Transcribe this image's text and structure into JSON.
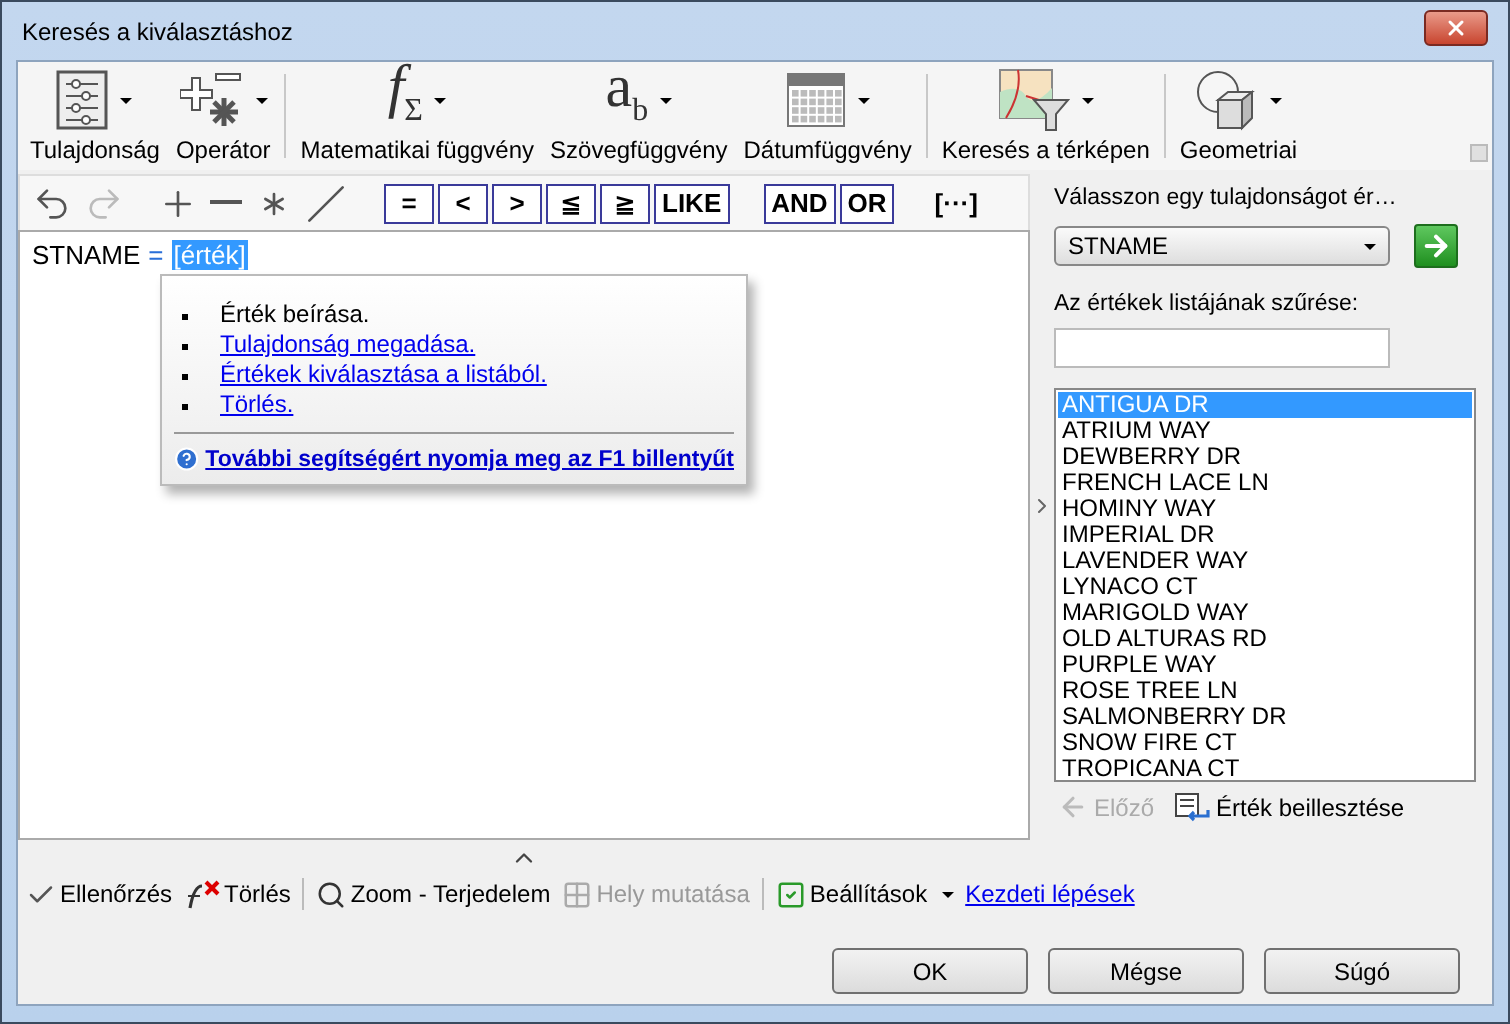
{
  "window": {
    "title": "Keresés a kiválasztáshoz"
  },
  "ribbon": [
    [
      {
        "kind": "property",
        "label": "Tulajdonság"
      },
      {
        "kind": "operator",
        "label": "Operátor"
      }
    ],
    [
      {
        "kind": "math",
        "label": "Matematikai függvény",
        "glyph": "*f*$_{Σ}$"
      },
      {
        "kind": "text",
        "label": "Szövegfüggvény",
        "glyph": "a$_{b}$"
      },
      {
        "kind": "date",
        "label": "Dátumfüggvény"
      }
    ],
    [
      {
        "kind": "map",
        "label": "Keresés a térképen"
      }
    ],
    [
      {
        "kind": "geometry",
        "label": "Geometriai"
      }
    ]
  ],
  "edit_tools": [
    [
      {
        "kind": "undo",
        "disabled": false
      },
      {
        "kind": "redo",
        "disabled": true
      }
    ],
    [
      {
        "kind": "plus",
        "disabled": false
      },
      {
        "kind": "minus",
        "disabled": false
      },
      {
        "kind": "multiply",
        "disabled": false
      },
      {
        "kind": "divide",
        "disabled": false
      }
    ]
  ],
  "operators": [
    [
      {
        "kind": "boxed",
        "label": "="
      },
      {
        "kind": "boxed",
        "label": "<"
      },
      {
        "kind": "boxed",
        "label": ">"
      },
      {
        "kind": "boxed",
        "label": "≦"
      },
      {
        "kind": "boxed",
        "label": "≧"
      },
      {
        "kind": "boxed",
        "label": "LIKE"
      }
    ],
    [
      {
        "kind": "boxed",
        "label": "AND"
      },
      {
        "kind": "boxed",
        "label": "OR"
      }
    ],
    [
      {
        "kind": "plain",
        "label": "[···]"
      }
    ]
  ],
  "expression": {
    "field": "STNAME",
    "operator": "=",
    "value": "[érték]"
  },
  "hint_popup": {
    "items": [
      {
        "text": "Érték beírása.",
        "link": false
      },
      {
        "text": "Tulajdonság megadása.",
        "link": true
      },
      {
        "text": "Értékek kiválasztása a listából.",
        "link": true
      },
      {
        "text": "Törlés.",
        "link": true
      }
    ],
    "help_link": "További segítségért nyomja meg az F1 billentyűt"
  },
  "value_panel": {
    "prompt": "Válasszon egy tulajdonságot ér…",
    "property": "STNAME",
    "filter_label": "Az értékek listájának szűrése:",
    "values": [
      {
        "text": "ANTIGUA DR",
        "selected": true
      },
      {
        "text": "ATRIUM WAY",
        "selected": false
      },
      {
        "text": "DEWBERRY DR",
        "selected": false
      },
      {
        "text": "FRENCH LACE LN",
        "selected": false
      },
      {
        "text": "HOMINY WAY",
        "selected": false
      },
      {
        "text": "IMPERIAL DR",
        "selected": false
      },
      {
        "text": "LAVENDER WAY",
        "selected": false
      },
      {
        "text": "LYNACO CT",
        "selected": false
      },
      {
        "text": "MARIGOLD WAY",
        "selected": false
      },
      {
        "text": "OLD ALTURAS RD",
        "selected": false
      },
      {
        "text": "PURPLE WAY",
        "selected": false
      },
      {
        "text": "ROSE TREE LN",
        "selected": false
      },
      {
        "text": "SALMONBERRY DR",
        "selected": false
      },
      {
        "text": "SNOW FIRE CT",
        "selected": false
      },
      {
        "text": "TROPICANA CT",
        "selected": false
      }
    ],
    "previous": {
      "label": "Előző",
      "disabled": true
    },
    "insert": {
      "label": "Érték beillesztése"
    }
  },
  "bottom_toolbar": [
    [
      {
        "kind": "verify",
        "label": "Ellenőrzés"
      },
      {
        "kind": "clear",
        "label": "Törlés"
      }
    ],
    [
      {
        "kind": "zoom",
        "label": "Zoom - Terjedelem"
      },
      {
        "kind": "locate",
        "label": "Hely mutatása",
        "disabled": true
      }
    ],
    [
      {
        "kind": "settings",
        "label": "Beállítások",
        "dropdown": true
      },
      {
        "kind": "link",
        "label": "Kezdeti lépések"
      }
    ]
  ],
  "buttons": [
    {
      "label": "OK"
    },
    {
      "label": "Mégse"
    },
    {
      "label": "Súgó"
    }
  ]
}
